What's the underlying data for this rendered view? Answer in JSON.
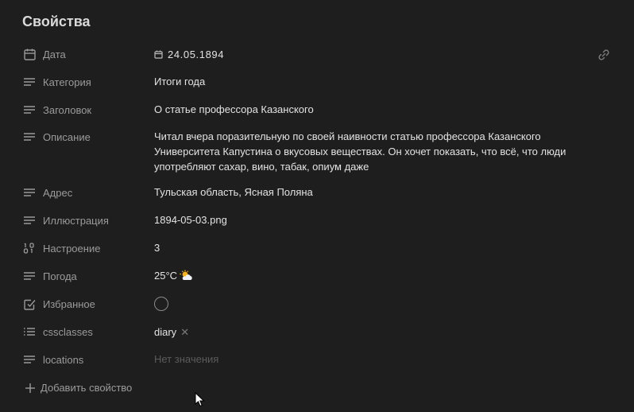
{
  "panel": {
    "title": "Свойства"
  },
  "properties": {
    "date": {
      "label": "Дата",
      "value": "24.05.1894",
      "icon": "calendar-icon"
    },
    "category": {
      "label": "Категория",
      "value": "Итоги года",
      "icon": "text-lines-icon"
    },
    "heading": {
      "label": "Заголовок",
      "value": "О статье профессора Казанского",
      "icon": "text-lines-icon"
    },
    "description": {
      "label": "Описание",
      "value": "Читал вчера поразительную по своей наивности статью профессора Казанского Университета Капустина о вкусовых веществах. Он хочет показать, что всё, что люди употребляют сахар, вино, табак, опиум даже",
      "icon": "text-lines-icon"
    },
    "address": {
      "label": "Адрес",
      "value": "Тульская область, Ясная Поляна",
      "icon": "text-lines-icon"
    },
    "illustration": {
      "label": "Иллюстрация",
      "value": "1894-05-03.png",
      "icon": "text-lines-icon"
    },
    "mood": {
      "label": "Настроение",
      "value": "3",
      "icon": "number-icon"
    },
    "weather": {
      "label": "Погода",
      "value": "25°C",
      "icon": "text-lines-icon",
      "emoji": "sun-behind-cloud-icon"
    },
    "favorite": {
      "label": "Избранное",
      "checked": false,
      "icon": "checkbox-icon"
    },
    "cssclasses": {
      "label": "cssclasses",
      "tag": "diary",
      "icon": "list-icon"
    },
    "locations": {
      "label": "locations",
      "placeholder": "Нет значения",
      "icon": "text-lines-icon"
    }
  },
  "add_property": {
    "label": "Добавить свойство"
  }
}
